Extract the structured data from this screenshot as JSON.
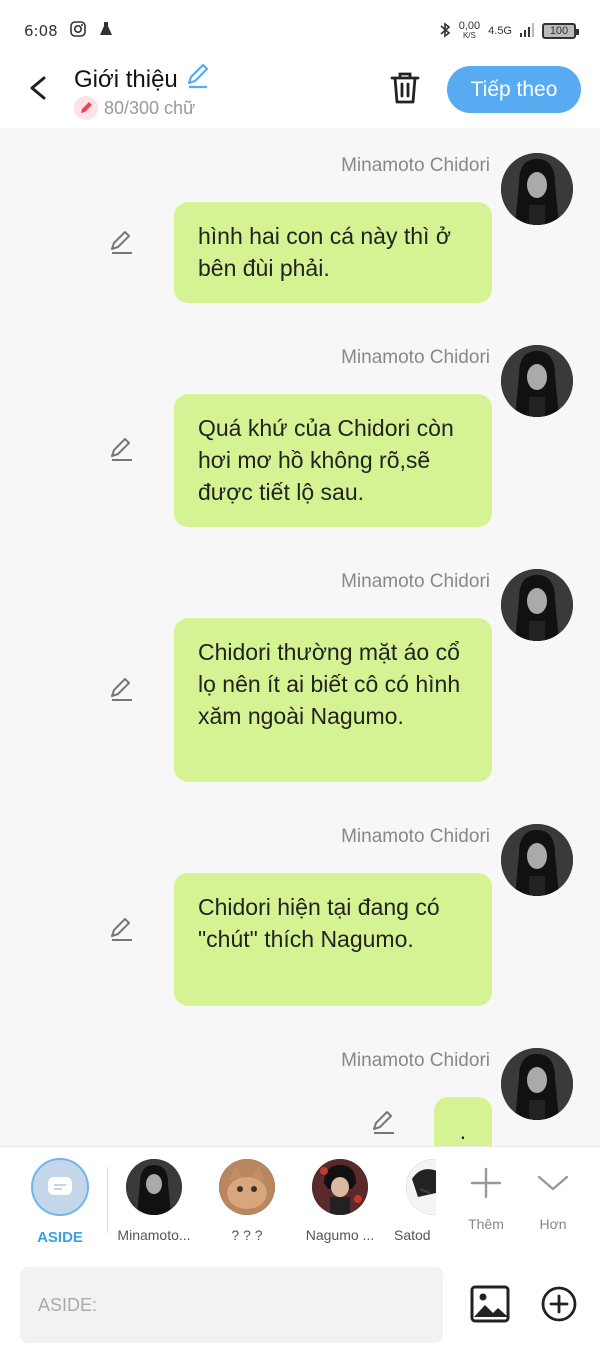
{
  "status_bar": {
    "time": "6:08",
    "net_speed": "0,00",
    "net_unit": "K/S",
    "network": "4.5G",
    "battery": "100"
  },
  "header": {
    "title": "Giới thiệu",
    "counter": "80/300 chữ",
    "next_label": "Tiếp theo"
  },
  "messages": [
    {
      "name": "Minamoto Chidori",
      "text": "hình hai con cá này thì ở bên đùi phải."
    },
    {
      "name": "Minamoto Chidori",
      "text": "Quá khứ của Chidori còn hơi mơ hồ không rõ,sẽ được tiết lộ sau."
    },
    {
      "name": "Minamoto Chidori",
      "text": "Chidori thường mặt áo cổ lọ nên ít ai biết cô có hình xăm ngoài Nagumo."
    },
    {
      "name": "Minamoto Chidori",
      "text": "Chidori hiện tại đang có \"chút\" thích Nagumo."
    },
    {
      "name": "Minamoto Chidori",
      "text": "."
    }
  ],
  "characters": [
    {
      "label": "ASIDE"
    },
    {
      "label": "Minamoto..."
    },
    {
      "label": "? ? ?"
    },
    {
      "label": "Nagumo ..."
    },
    {
      "label": "Satod"
    }
  ],
  "tools": {
    "add_label": "Thêm",
    "more_label": "Hơn"
  },
  "input": {
    "placeholder": "ASIDE:"
  },
  "colors": {
    "accent": "#58aaf1",
    "bubble": "#d6f394"
  }
}
